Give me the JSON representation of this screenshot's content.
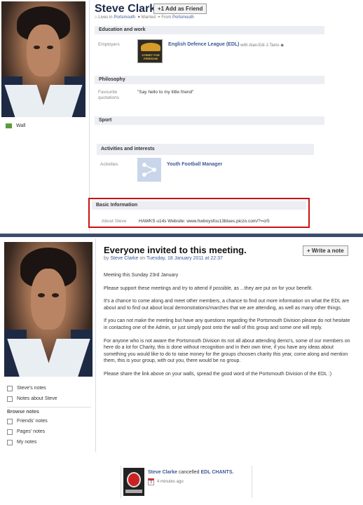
{
  "profile": {
    "name": "Steve Clarke",
    "add_friend": "+1 Add as Friend",
    "lives_in_label": "Lives in",
    "lives_in_value": "Portsmouth",
    "married": "Married",
    "from_label": "From",
    "from_value": "Portsmouth",
    "wall": "Wall"
  },
  "education_work": {
    "header": "Education and work",
    "employers_label": "Employers",
    "employer_logo_text": "STREET FOR FREEDOM",
    "employer": "English Defence League (EDL)",
    "with_text": "with Alan-Edi J-Tams"
  },
  "philosophy": {
    "header": "Philosophy",
    "quotations_label": "Favourite quotations",
    "quote": "\"Say hello to my little friend\""
  },
  "sport": {
    "header": "Sport"
  },
  "activities": {
    "header": "Activities and interests",
    "activities_label": "Activities",
    "activity": "Youth Football Manager"
  },
  "basic_info": {
    "header": "Basic Information",
    "about_label": "About Steve",
    "about_value": "HAWKS u14s Website: www.hwboysfcu13blues.piczo.com/?=cr5"
  },
  "note": {
    "title": "Everyone invited to this meeting.",
    "byline_by": "by",
    "byline_author": "Steve Clarke",
    "byline_on": "on",
    "byline_date": "Tuesday, 18 January 2011 at 22:37",
    "write_note": "+ Write a note",
    "paragraphs": [
      "Meeting this Sunday 23rd January",
      "Please support these meetings and try to attend if possible, as ...they are put on for your benefit.",
      "It's a chance to come along and meet other members, a chance to find out more information on what the EDL are about and to find out about local demonstrations/marches that we are attending, as well as many other things.",
      "If you can not make the meeting but have any questions regarding the Portsmouth Division please do not hesitate in contacting one of the Admin, or just simply post onto the wall of this group and some one will reply.",
      "For anyone who is not aware the Portsmouth Division its not all about attending demo's, some of our members on here do a lot for Charity, this is done without recognition and in their own time, if you have any ideas about something you would like to do to raise money for the groups choosen charity this year, come along and mention them, this is your group, with out you, there would be no group.",
      "Please share the link above on your walls, spread the good word of the Portsmouth Division of the EDL :)"
    ]
  },
  "sidebar": {
    "steves_notes": "Steve's notes",
    "notes_about": "Notes about Steve",
    "browse_header": "Browse notes",
    "friends_notes": "Friends' notes",
    "pages_notes": "Pages' notes",
    "my_notes": "My notes"
  },
  "activity_item": {
    "actor": "Steve Clarke",
    "action": "cancelled",
    "object": "EDL CHANTS.",
    "calendar_day": "3",
    "time": "4 minutes ago"
  },
  "colors": {
    "link_blue": "#3b5998",
    "highlight_red": "#cc1111",
    "bar_gray": "#eceef4"
  }
}
